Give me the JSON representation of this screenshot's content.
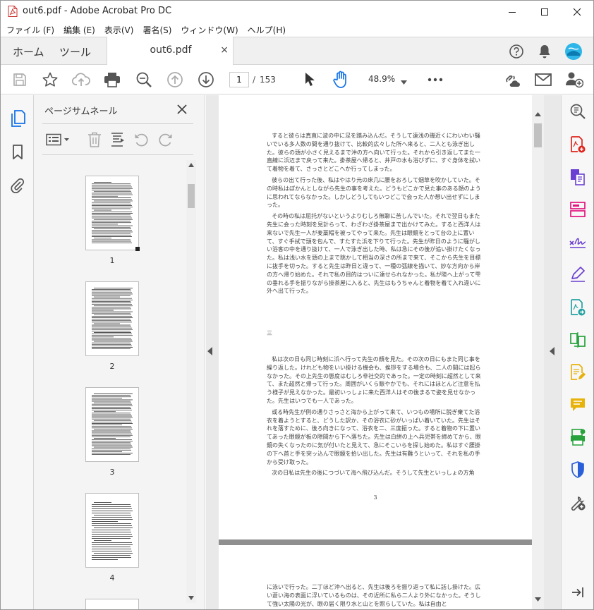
{
  "window": {
    "title": "out6.pdf - Adobe Acrobat Pro DC"
  },
  "menu": [
    "ファイル (F)",
    "編集 (E)",
    "表示(V)",
    "署名(S)",
    "ウィンドウ(W)",
    "ヘルプ(H)"
  ],
  "tabs": {
    "home": "ホーム",
    "tools": "ツール",
    "document": "out6.pdf",
    "close_glyph": "×"
  },
  "toolbar": {
    "current_page": "1",
    "separator": "/",
    "total_pages": "153",
    "zoom": "48.9%"
  },
  "panel": {
    "title": "ページサムネール",
    "thumbnails": [
      {
        "label": "1"
      },
      {
        "label": "2"
      },
      {
        "label": "3"
      },
      {
        "label": "4"
      }
    ]
  },
  "document": {
    "paragraphs": [
      "すると彼らは真直に波の中に足を踏み込んだ。そうして遠浅の磯近くにわいわい騒いでいる多人数の間を通り抜けて、比較的広々した所へ来ると、二人とも泳ぎ出した。彼らの頭が小さく見えるまで沖の方へ向いて行った。それから引き返してまた一直線に浜辺まで戻って来た。掛茶屋へ帰ると、井戸の水も浴びずに、すぐ身体を拭いて着物を着て、さっさとどこへか行ってしまった。",
      "彼らの出て行った後、私はやはり元の床几に腰をおろして烟草を吹かしていた。その時私はぽかんとしながら先生の事を考えた。どうもどこかで見た事のある顔のように思われてならなかった。しかしどうしてもいつどこで会った人か想い出せずにしまった。",
      "その時の私は屈托がないというよりむしろ無聊に苦しんでいた。それで翌日もまた先生に会った時刻を見計らって、わざわざ掛茶屋まで出かけてみた。すると西洋人は来ないで先生一人が麦藁帽を被ってやって来た。先生は眼鏡をとって台の上に置いて、すぐ手拭で頭を包んで、すたすた浜を下りて行った。先生が昨日のように騒がしい浴客の中を通り抜けて、一人で泳ぎ出した時、私は急にその後が追い掛けたくなった。私は浅い水を頭の上まで跳かして相当の深さの所まで来て、そこから先生を目標に抜手を切った。すると先生は昨日と違って、一種の弧線を描いて、妙な方向から岸の方へ帰り始めた。それで私の目的はついに達せられなかった。私が陸へ上がって雫の垂れる手を振りながら掛茶屋に入ると、先生はもうちゃんと着物を着て入れ違いに外へ出て行った。"
    ],
    "section_mark": "三",
    "paragraphs_2": [
      "私は次の日も同じ時刻に浜へ行って先生の顔を見た。その次の日にもまた同じ事を繰り返した。けれども物をいい掛ける機会も、挨拶をする場合も、二人の間には起らなかった。その上先生の態度はむしろ非社交的であった。一定の時刻に超然として来て、また超然と帰って行った。周囲がいくら賑やかでも、それにはほとんど注意を払う様子が見えなかった。最初いっしょに来た西洋人はその後まるで姿を見せなかった。先生はいつでも一人であった。",
      "或る時先生が例の通りさっさと海から上がって来て、いつもの場所に脱ぎ棄てた浴衣を着ようとすると、どうした訳か、その浴衣に砂がいっぱい着いていた。先生はそれを落すために、後ろ向きになって、浴衣を二、三度振った。すると着物の下に置いてあった眼鏡が板の隙間から下へ落ちた。先生は白絣の上へ兵児帯を締めてから、眼鏡の失くなったのに気が付いたと見えて、急にそこいらを探し始めた。私はすぐ腰掛の下へ首と手を突ッ込んで眼鏡を拾い出した。先生は有難うといって、それを私の手から受け取った。",
      "次の日私は先生の後につづいて海へ飛び込んだ。そうして先生といっしょの方角"
    ],
    "page_number": "3",
    "next_page_text": "に泳いで行った。二丁ほど沖へ出ると、先生は後ろを振り返って私に話し掛けた。広い蒼い海の表面に浮いているものは、その近所に私ら二人より外になかった。そうして強い太陽の光が、眼の届く限り水と山とを照らしていた。私は自由と"
  },
  "colors": {
    "accent": "#1473e6",
    "acrobat_red": "#e0241b",
    "tool_purple": "#6a3fd1",
    "tool_green": "#27a23c",
    "tool_yellow": "#e8b20c",
    "tool_pink": "#e2157f",
    "tool_blue": "#2b5fd9"
  }
}
